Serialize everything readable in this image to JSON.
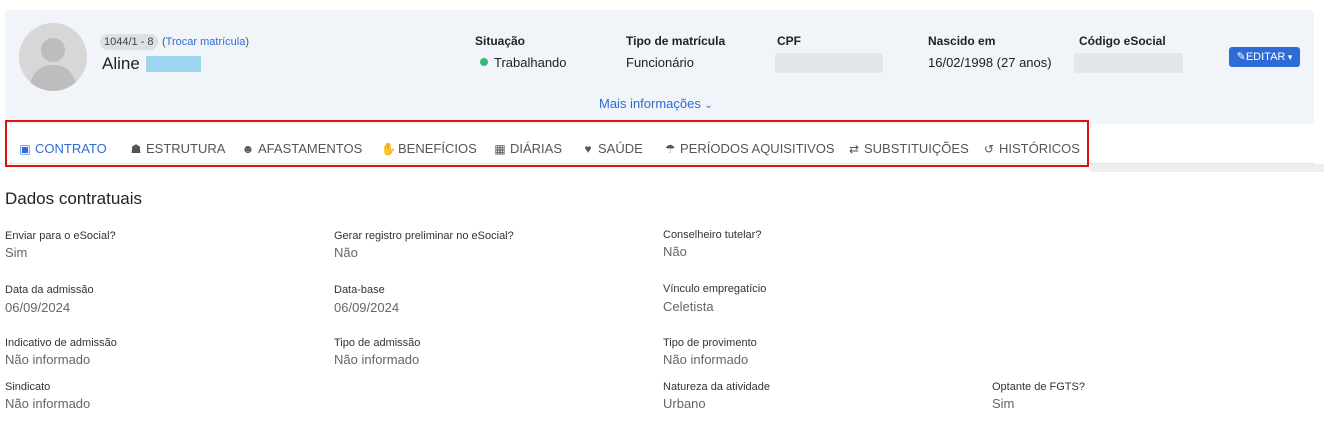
{
  "employee": {
    "registration": "1044/1 - 8",
    "switch_link": "Trocar matrícula",
    "first_name": "Aline"
  },
  "info": [
    {
      "label": "Situação",
      "value": "Trabalhando"
    },
    {
      "label": "Tipo de matrícula",
      "value": "Funcionário"
    },
    {
      "label": "CPF",
      "value": ""
    },
    {
      "label": "Nascido em",
      "value": "16/02/1998 (27 anos)"
    },
    {
      "label": "Código eSocial",
      "value": ""
    }
  ],
  "edit_label": "EDITAR",
  "more_info": "Mais informações",
  "tabs": [
    {
      "label": "CONTRATO",
      "icon": "id-badge-icon",
      "active": true
    },
    {
      "label": "ESTRUTURA",
      "icon": "sitemap-icon"
    },
    {
      "label": "AFASTAMENTOS",
      "icon": "user-x-icon"
    },
    {
      "label": "BENEFÍCIOS",
      "icon": "hand-gift-icon"
    },
    {
      "label": "DIÁRIAS",
      "icon": "building-icon"
    },
    {
      "label": "SAÚDE",
      "icon": "heartbeat-icon"
    },
    {
      "label": "PERÍODOS AQUISITIVOS",
      "icon": "beach-umbrella-icon"
    },
    {
      "label": "SUBSTITUIÇÕES",
      "icon": "swap-arrows-icon"
    },
    {
      "label": "HISTÓRICOS",
      "icon": "history-icon"
    }
  ],
  "section_title": "Dados contratuais",
  "fields": {
    "enviar_esocial": {
      "label": "Enviar para o eSocial?",
      "value": "Sim"
    },
    "gerar_registro": {
      "label": "Gerar registro preliminar no eSocial?",
      "value": "Não"
    },
    "conselheiro": {
      "label": "Conselheiro tutelar?",
      "value": "Não"
    },
    "data_admissao": {
      "label": "Data da admissão",
      "value": "06/09/2024"
    },
    "data_base": {
      "label": "Data-base",
      "value": "06/09/2024"
    },
    "vinculo": {
      "label": "Vínculo empregatício",
      "value": "Celetista"
    },
    "indicativo": {
      "label": "Indicativo de admissão",
      "value": "Não informado"
    },
    "tipo_admissao": {
      "label": "Tipo de admissão",
      "value": "Não informado"
    },
    "tipo_provimento": {
      "label": "Tipo de provimento",
      "value": "Não informado"
    },
    "sindicato": {
      "label": "Sindicato",
      "value": "Não informado"
    },
    "natureza": {
      "label": "Natureza da atividade",
      "value": "Urbano"
    },
    "fgts": {
      "label": "Optante de FGTS?",
      "value": "Sim"
    }
  }
}
